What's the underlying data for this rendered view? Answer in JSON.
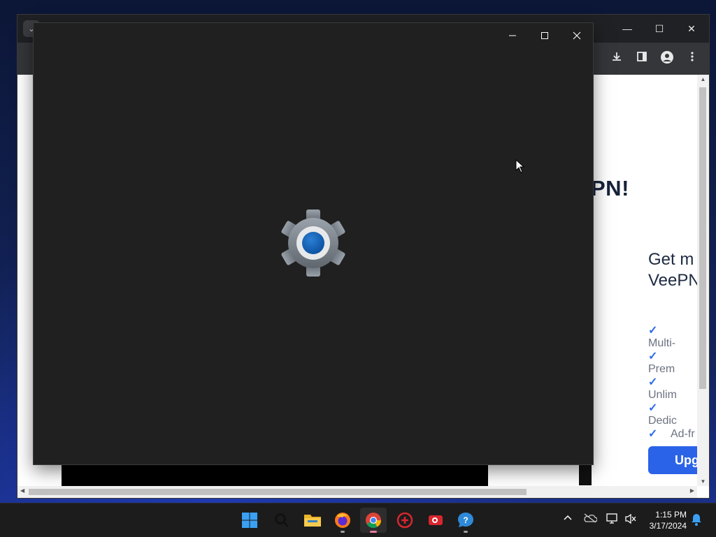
{
  "chrome": {
    "close_symbol": "✕",
    "minimize_symbol": "—",
    "maximize_symbol": "☐",
    "tab_menu_symbol": "⌄"
  },
  "webpage": {
    "headline_fragment": "PN!",
    "card_title_line1": "Get m",
    "card_title_line2": "VeePN",
    "features": [
      "Multi-",
      "Prem",
      "Unlim",
      "Dedic",
      "Ad-fr"
    ],
    "upgrade_button": "Upg",
    "accent_color": "#2b63e8"
  },
  "settings_window": {
    "icon": "gear-icon",
    "background": "#202020"
  },
  "taskbar": {
    "apps": [
      {
        "name": "start",
        "icon": "windows-logo-icon"
      },
      {
        "name": "search",
        "icon": "search-icon"
      },
      {
        "name": "file-explorer",
        "icon": "folder-icon"
      },
      {
        "name": "firefox",
        "icon": "firefox-icon"
      },
      {
        "name": "chrome",
        "icon": "chrome-icon",
        "active": true
      },
      {
        "name": "app-red-1",
        "icon": "red-app-icon"
      },
      {
        "name": "app-red-2",
        "icon": "camera-app-icon"
      },
      {
        "name": "help",
        "icon": "help-icon"
      }
    ],
    "clock_time": "1:15 PM",
    "clock_date": "3/17/2024"
  }
}
